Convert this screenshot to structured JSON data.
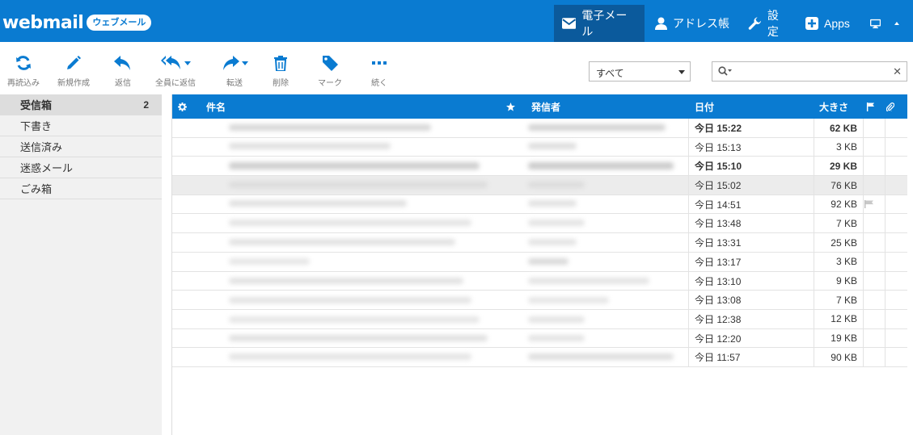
{
  "app": {
    "logo": "webmail",
    "badge": "ウェブメール"
  },
  "nav": [
    {
      "label": "電子メール",
      "icon": "envelope-icon"
    },
    {
      "label": "アドレス帳",
      "icon": "person-icon"
    },
    {
      "label": "設定",
      "icon": "wrench-icon"
    },
    {
      "label": "Apps",
      "icon": "plus-square-icon"
    }
  ],
  "toolbar": {
    "refresh": "再読込み",
    "compose": "新規作成",
    "reply": "返信",
    "reply_all": "全員に返信",
    "forward": "転送",
    "delete": "削除",
    "mark": "マーク",
    "more": "続く"
  },
  "filter": {
    "value": "すべて"
  },
  "search": {
    "placeholder": ""
  },
  "folders": [
    {
      "name": "受信箱",
      "count": "2"
    },
    {
      "name": "下書き",
      "count": ""
    },
    {
      "name": "送信済み",
      "count": ""
    },
    {
      "name": "迷惑メール",
      "count": ""
    },
    {
      "name": "ごみ箱",
      "count": ""
    }
  ],
  "columns": {
    "subject": "件名",
    "from": "発信者",
    "date": "日付",
    "size": "大きさ"
  },
  "messages": [
    {
      "date": "今日 15:22",
      "size": "62 KB",
      "unread": true,
      "flagged": false
    },
    {
      "date": "今日 15:13",
      "size": "3 KB",
      "unread": false,
      "flagged": false
    },
    {
      "date": "今日 15:10",
      "size": "29 KB",
      "unread": true,
      "flagged": false
    },
    {
      "date": "今日 15:02",
      "size": "76 KB",
      "unread": false,
      "flagged": false
    },
    {
      "date": "今日 14:51",
      "size": "92 KB",
      "unread": false,
      "flagged": true
    },
    {
      "date": "今日 13:48",
      "size": "7 KB",
      "unread": false,
      "flagged": false
    },
    {
      "date": "今日 13:31",
      "size": "25 KB",
      "unread": false,
      "flagged": false
    },
    {
      "date": "今日 13:17",
      "size": "3 KB",
      "unread": false,
      "flagged": false
    },
    {
      "date": "今日 13:10",
      "size": "9 KB",
      "unread": false,
      "flagged": false
    },
    {
      "date": "今日 13:08",
      "size": "7 KB",
      "unread": false,
      "flagged": false
    },
    {
      "date": "今日 12:38",
      "size": "12 KB",
      "unread": false,
      "flagged": false
    },
    {
      "date": "今日 12:20",
      "size": "19 KB",
      "unread": false,
      "flagged": false
    },
    {
      "date": "今日 11:57",
      "size": "90 KB",
      "unread": false,
      "flagged": false
    }
  ],
  "colors": {
    "primary": "#0a7bd1",
    "nav_active": "#0b5a9c",
    "sidebar": "#f1f1f1"
  }
}
